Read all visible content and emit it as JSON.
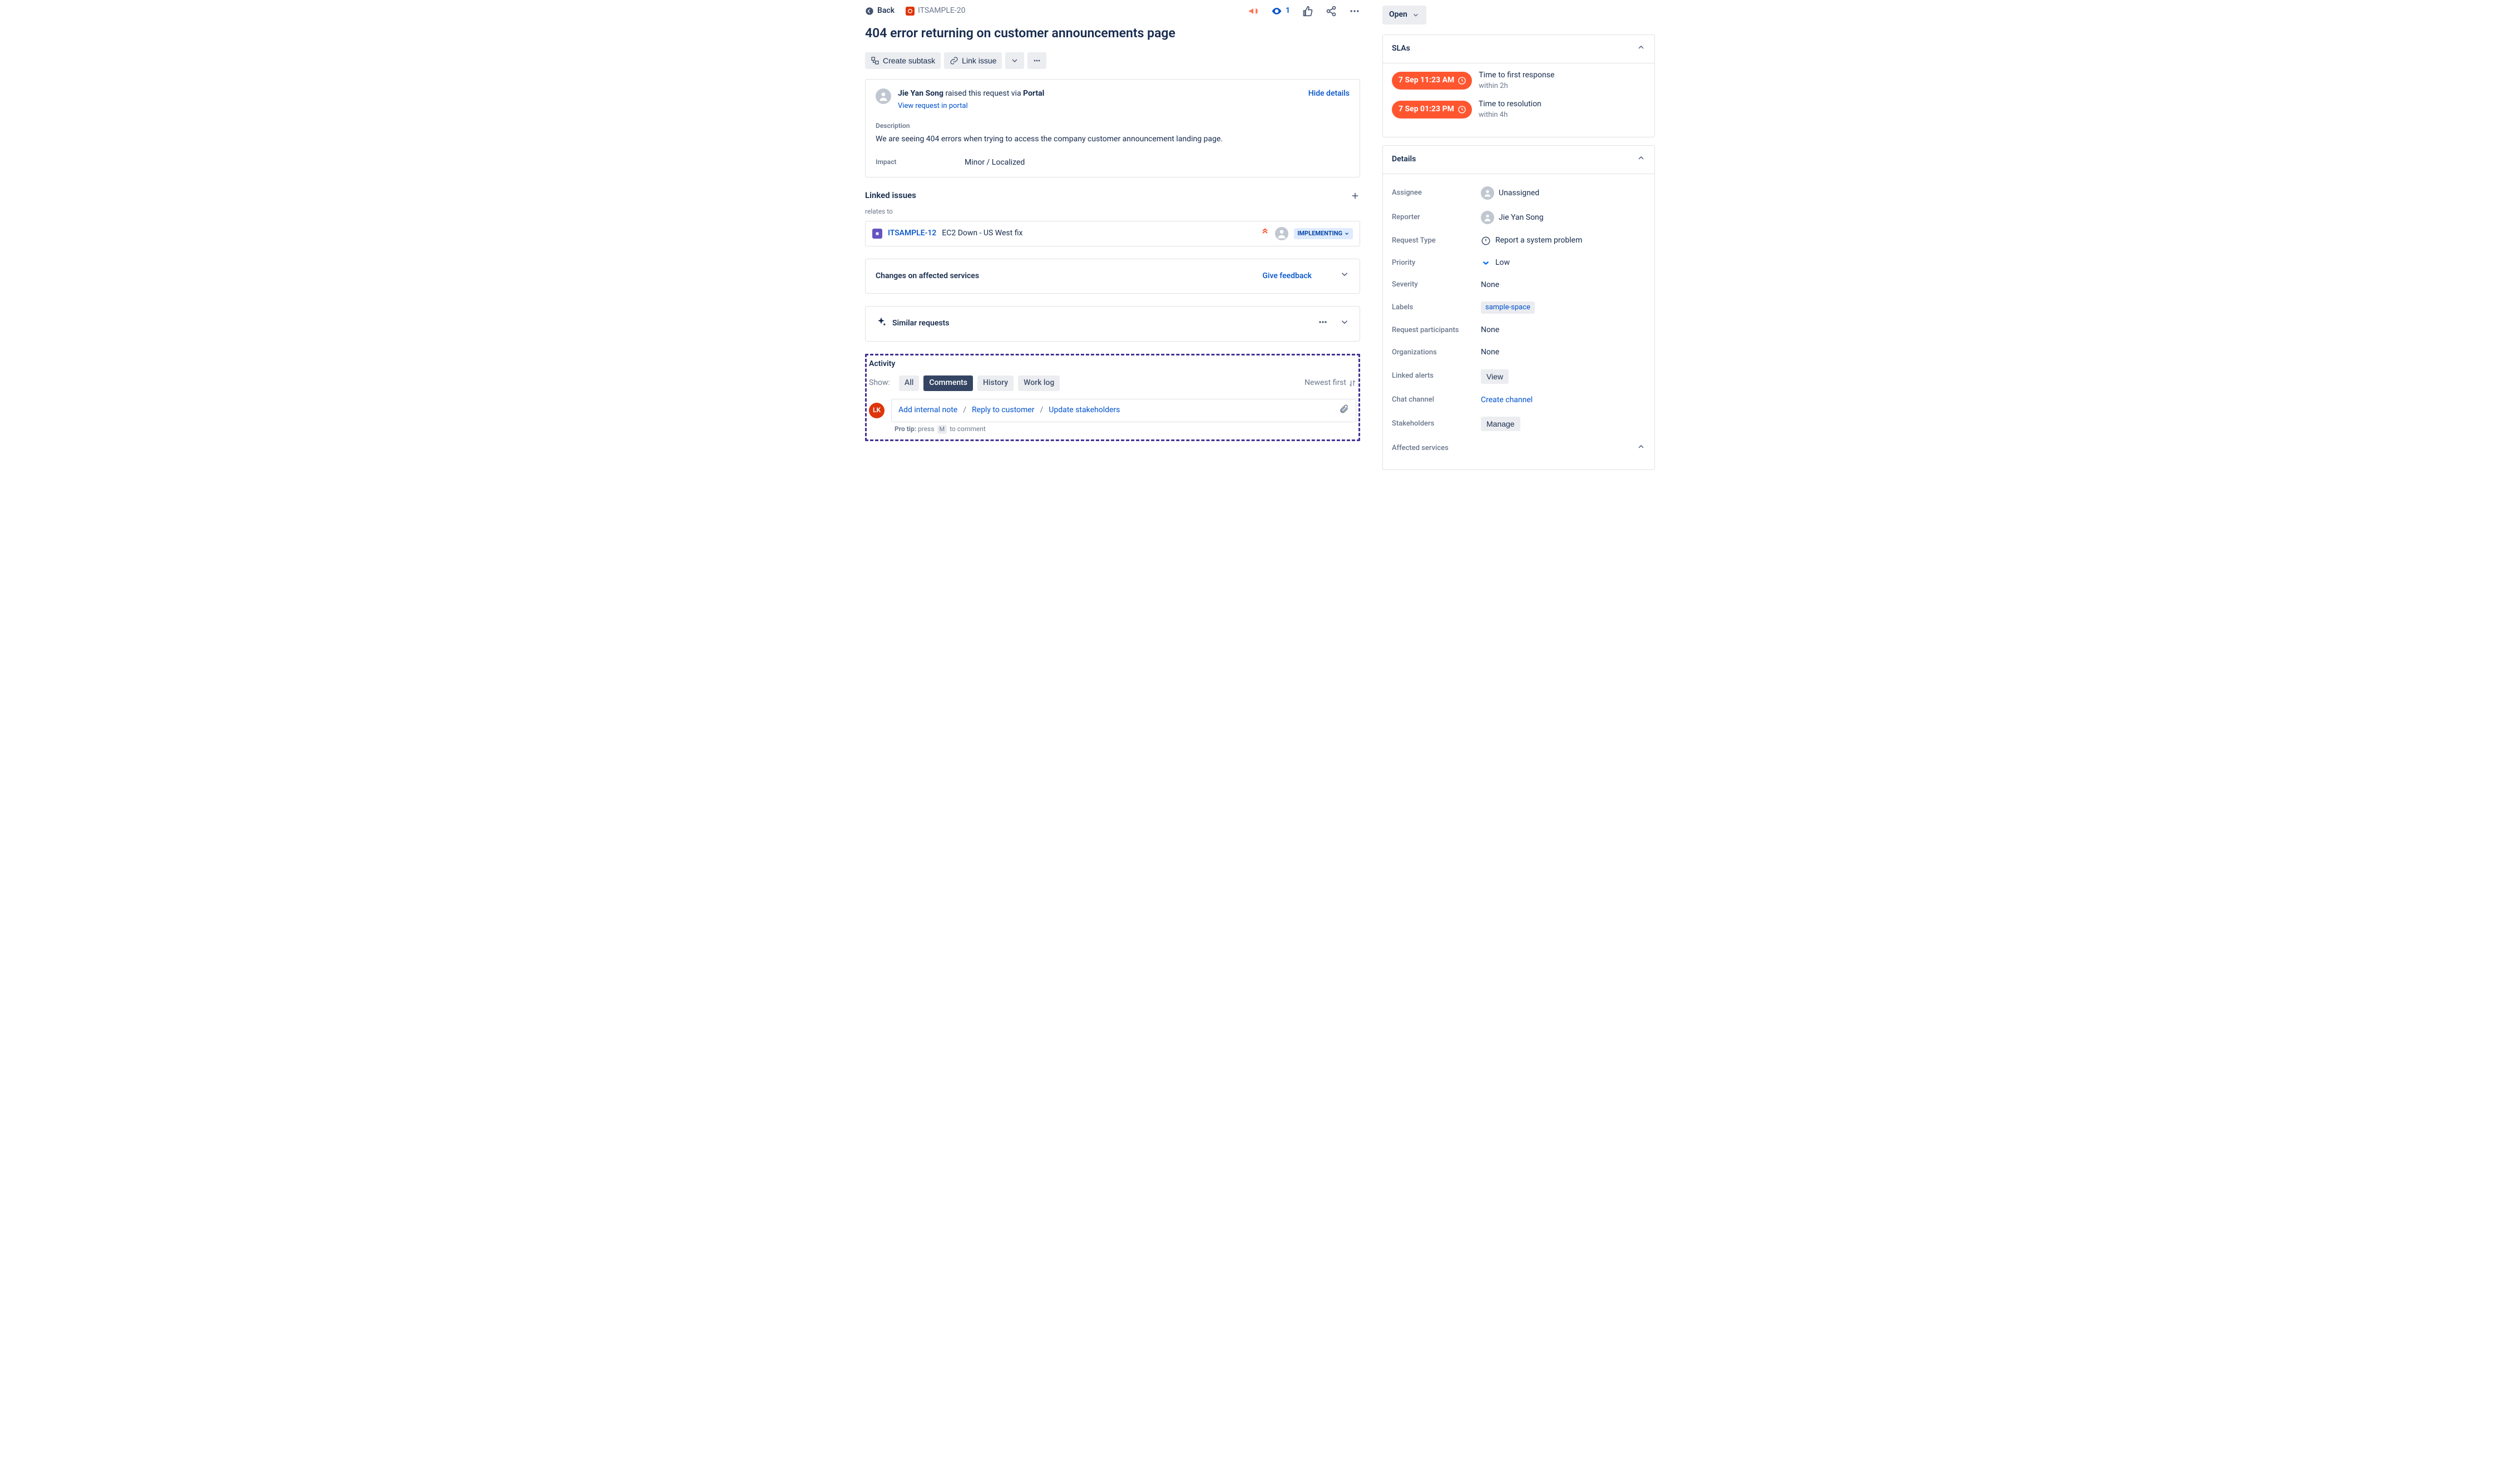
{
  "header": {
    "back": "Back",
    "issueKey": "ITSAMPLE-20",
    "watchCount": "1"
  },
  "issueTitle": "404 error returning on customer announcements page",
  "toolbar": {
    "createSubtask": "Create subtask",
    "linkIssue": "Link issue"
  },
  "request": {
    "reporter": "Jie Yan Song",
    "raisedVia1": " raised this request via ",
    "raisedVia2": "Portal",
    "hideDetails": "Hide details",
    "viewPortal": "View request in portal",
    "descLabel": "Description",
    "descText": "We are seeing 404 errors when trying to access the company customer announcement landing page.",
    "impactLabel": "Impact",
    "impactValue": "Minor / Localized"
  },
  "linked": {
    "heading": "Linked issues",
    "relationship": "relates to",
    "key": "ITSAMPLE-12",
    "title": "EC2 Down - US West fix",
    "status": "IMPLEMENTING"
  },
  "changes": {
    "title": "Changes on affected services",
    "feedback": "Give feedback"
  },
  "similar": {
    "title": "Similar requests"
  },
  "activity": {
    "title": "Activity",
    "show": "Show:",
    "tabs": {
      "all": "All",
      "comments": "Comments",
      "history": "History",
      "worklog": "Work log"
    },
    "sort": "Newest first",
    "avatarInitials": "LK",
    "links": {
      "internal": "Add internal note",
      "reply": "Reply to customer",
      "stakeholders": "Update stakeholders"
    },
    "tip1": "Pro tip:",
    "tip2": "press",
    "tipKey": "M",
    "tip3": "to comment"
  },
  "status": {
    "label": "Open"
  },
  "slas": {
    "title": "SLAs",
    "items": [
      {
        "badge": "7 Sep 11:23 AM",
        "label": "Time to first response",
        "within": "within 2h"
      },
      {
        "badge": "7 Sep 01:23 PM",
        "label": "Time to resolution",
        "within": "within 4h"
      }
    ]
  },
  "details": {
    "title": "Details",
    "assignee": {
      "k": "Assignee",
      "v": "Unassigned"
    },
    "reporter": {
      "k": "Reporter",
      "v": "Jie Yan Song"
    },
    "requestType": {
      "k": "Request Type",
      "v": "Report a system problem"
    },
    "priority": {
      "k": "Priority",
      "v": "Low"
    },
    "severity": {
      "k": "Severity",
      "v": "None"
    },
    "labels": {
      "k": "Labels",
      "v": "sample-space"
    },
    "participants": {
      "k": "Request participants",
      "v": "None"
    },
    "organizations": {
      "k": "Organizations",
      "v": "None"
    },
    "linkedAlerts": {
      "k": "Linked alerts",
      "v": "View"
    },
    "chat": {
      "k": "Chat channel",
      "v": "Create channel"
    },
    "stakeholders": {
      "k": "Stakeholders",
      "v": "Manage"
    },
    "affected": {
      "k": "Affected services"
    }
  }
}
